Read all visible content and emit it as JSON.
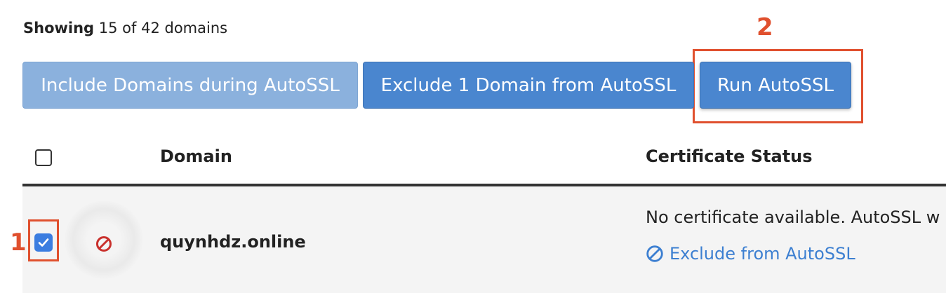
{
  "summary": {
    "showing_label": "Showing",
    "showing_count": "15 of 42 domains"
  },
  "toolbar": {
    "include_label": "Include Domains during AutoSSL",
    "exclude_label": "Exclude 1 Domain from AutoSSL",
    "run_label": "Run AutoSSL"
  },
  "annotations": {
    "step1": "1",
    "step2": "2",
    "color": "#e0502e"
  },
  "table": {
    "columns": [
      "Domain",
      "Certificate Status"
    ],
    "rows": [
      {
        "checked": true,
        "status_icon": "ban-icon",
        "domain": "quynhdz.online",
        "status_text": "No certificate available. AutoSSL w",
        "action_label": "Exclude from AutoSSL"
      }
    ]
  },
  "colors": {
    "primary": "#4a86cf",
    "primary_disabled": "#8bb1dd",
    "link": "#3c7fd1",
    "error": "#c9302c"
  }
}
